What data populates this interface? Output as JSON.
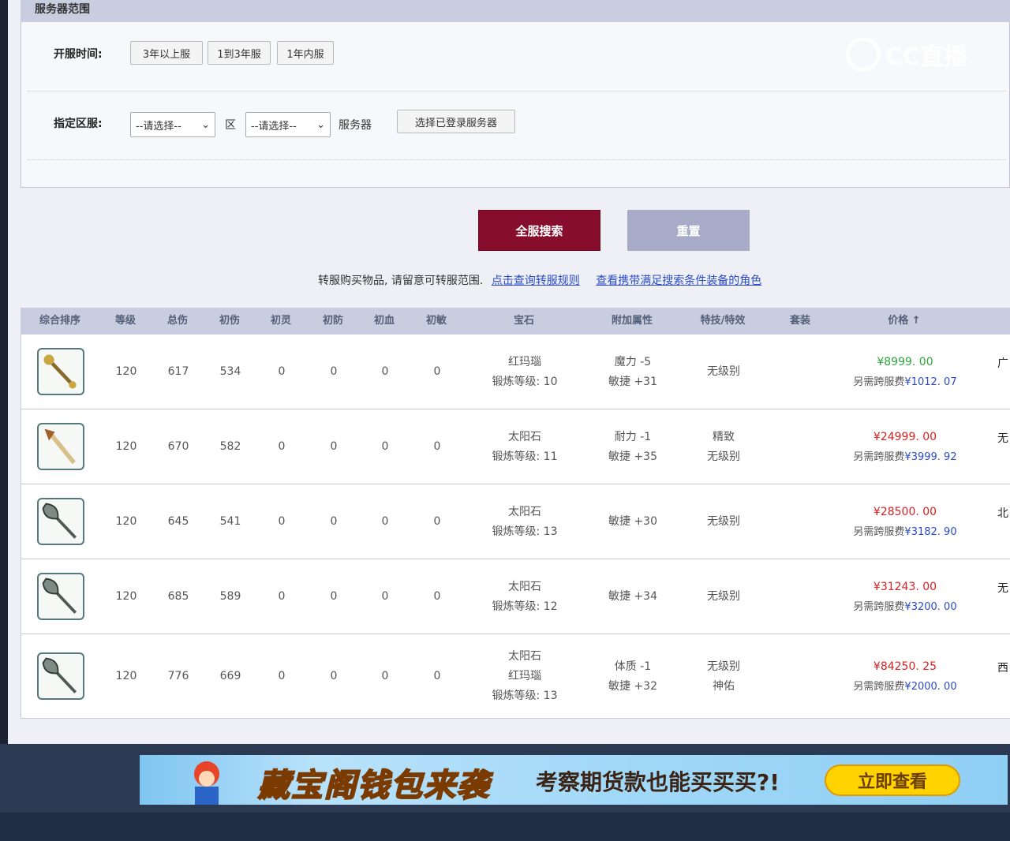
{
  "section": {
    "title": "服务器范围"
  },
  "filters": {
    "open_time_label": "开服时间:",
    "open_time_buttons": [
      "3年以上服",
      "1到3年服",
      "1年内服"
    ],
    "zone_label": "指定区服:",
    "zone_select": "--请选择--",
    "zone_suffix": "区",
    "server_select": "--请选择--",
    "server_suffix": "服务器",
    "choose_logged_button": "选择已登录服务器"
  },
  "overlay_logo": "CC直播",
  "actions": {
    "search": "全服搜索",
    "reset": "重置"
  },
  "notice": {
    "text": "转服购买物品, 请留意可转服范围.",
    "link1": "点击查询转服规则",
    "link2": "查看携带满足搜索条件装备的角色"
  },
  "table": {
    "headers": [
      "综合排序",
      "等级",
      "总伤",
      "初伤",
      "初灵",
      "初防",
      "初血",
      "初敏",
      "宝石",
      "附加属性",
      "特技/特效",
      "套装",
      "价格 ↑"
    ],
    "rows": [
      {
        "icon": "staff-icon",
        "level": "120",
        "total": "617",
        "init_dmg": "534",
        "init_spirit": "0",
        "init_def": "0",
        "init_hp": "0",
        "init_agi": "0",
        "gem": [
          "红玛瑙",
          "锻炼等级: 10"
        ],
        "attrs": [
          "魔力 -5",
          "敏捷 +31"
        ],
        "skill": [
          "无级别"
        ],
        "price": "¥8999. 00",
        "price_color": "green",
        "fee": "另需跨服费",
        "fee_val": "¥1012. 07",
        "edge": "广"
      },
      {
        "icon": "spear-icon",
        "level": "120",
        "total": "670",
        "init_dmg": "582",
        "init_spirit": "0",
        "init_def": "0",
        "init_hp": "0",
        "init_agi": "0",
        "gem": [
          "太阳石",
          "锻炼等级: 11"
        ],
        "attrs": [
          "耐力 -1",
          "敏捷 +35"
        ],
        "skill": [
          "精致",
          "无级别"
        ],
        "price": "¥24999. 00",
        "price_color": "red",
        "fee": "另需跨服费",
        "fee_val": "¥3999. 92",
        "edge": "无"
      },
      {
        "icon": "axe-icon",
        "level": "120",
        "total": "645",
        "init_dmg": "541",
        "init_spirit": "0",
        "init_def": "0",
        "init_hp": "0",
        "init_agi": "0",
        "gem": [
          "太阳石",
          "锻炼等级: 13"
        ],
        "attrs": [
          "敏捷 +30"
        ],
        "skill": [
          "无级别"
        ],
        "price": "¥28500. 00",
        "price_color": "red",
        "fee": "另需跨服费",
        "fee_val": "¥3182. 90",
        "edge": "北"
      },
      {
        "icon": "axe-icon",
        "level": "120",
        "total": "685",
        "init_dmg": "589",
        "init_spirit": "0",
        "init_def": "0",
        "init_hp": "0",
        "init_agi": "0",
        "gem": [
          "太阳石",
          "锻炼等级: 12"
        ],
        "attrs": [
          "敏捷 +34"
        ],
        "skill": [
          "无级别"
        ],
        "price": "¥31243. 00",
        "price_color": "red",
        "fee": "另需跨服费",
        "fee_val": "¥3200. 00",
        "edge": "无"
      },
      {
        "icon": "axe-icon",
        "level": "120",
        "total": "776",
        "init_dmg": "669",
        "init_spirit": "0",
        "init_def": "0",
        "init_hp": "0",
        "init_agi": "0",
        "gem": [
          "太阳石",
          "红玛瑙",
          "锻炼等级: 13"
        ],
        "attrs": [
          "体质 -1",
          "敏捷 +32"
        ],
        "skill": [
          "无级别",
          "神佑"
        ],
        "price": "¥84250. 25",
        "price_color": "red",
        "fee": "另需跨服费",
        "fee_val": "¥2000. 00",
        "edge": "西"
      }
    ]
  },
  "banner": {
    "title": "藏宝阁钱包来袭",
    "subtitle": "考察期货款也能买买买?!",
    "cta": "立即查看"
  },
  "colors": {
    "primary": "#860d2b",
    "reset": "#a7abc8",
    "header_bg": "#c8cde0",
    "link": "#2b4bc6",
    "price_green": "#2ea63d",
    "price_red": "#d62121"
  }
}
